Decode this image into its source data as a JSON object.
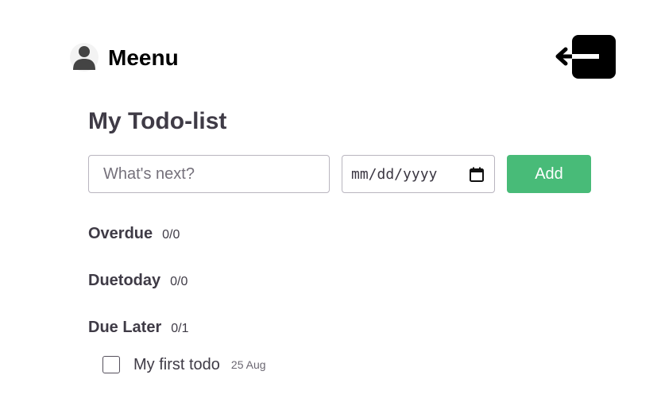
{
  "header": {
    "user_icon": "person-icon",
    "user_name": "Meenu",
    "logout_icon": "logout-arrow-icon"
  },
  "main": {
    "title": "My Todo-list",
    "todo_input": {
      "placeholder": "What's next?",
      "value": ""
    },
    "date_input": {
      "display": "mm/dd/yyyy",
      "icon": "calendar-icon"
    },
    "add_button": "Add"
  },
  "sections": [
    {
      "title": "Overdue",
      "count": "0/0"
    },
    {
      "title": "Duetoday",
      "count": "0/0"
    },
    {
      "title": "Due Later",
      "count": "0/1",
      "items": [
        {
          "text": "My first todo",
          "date": "25 Aug",
          "checked": false
        }
      ]
    }
  ],
  "colors": {
    "accent": "#48bb78",
    "text": "#3f3b46",
    "border": "#b9b5bf"
  }
}
